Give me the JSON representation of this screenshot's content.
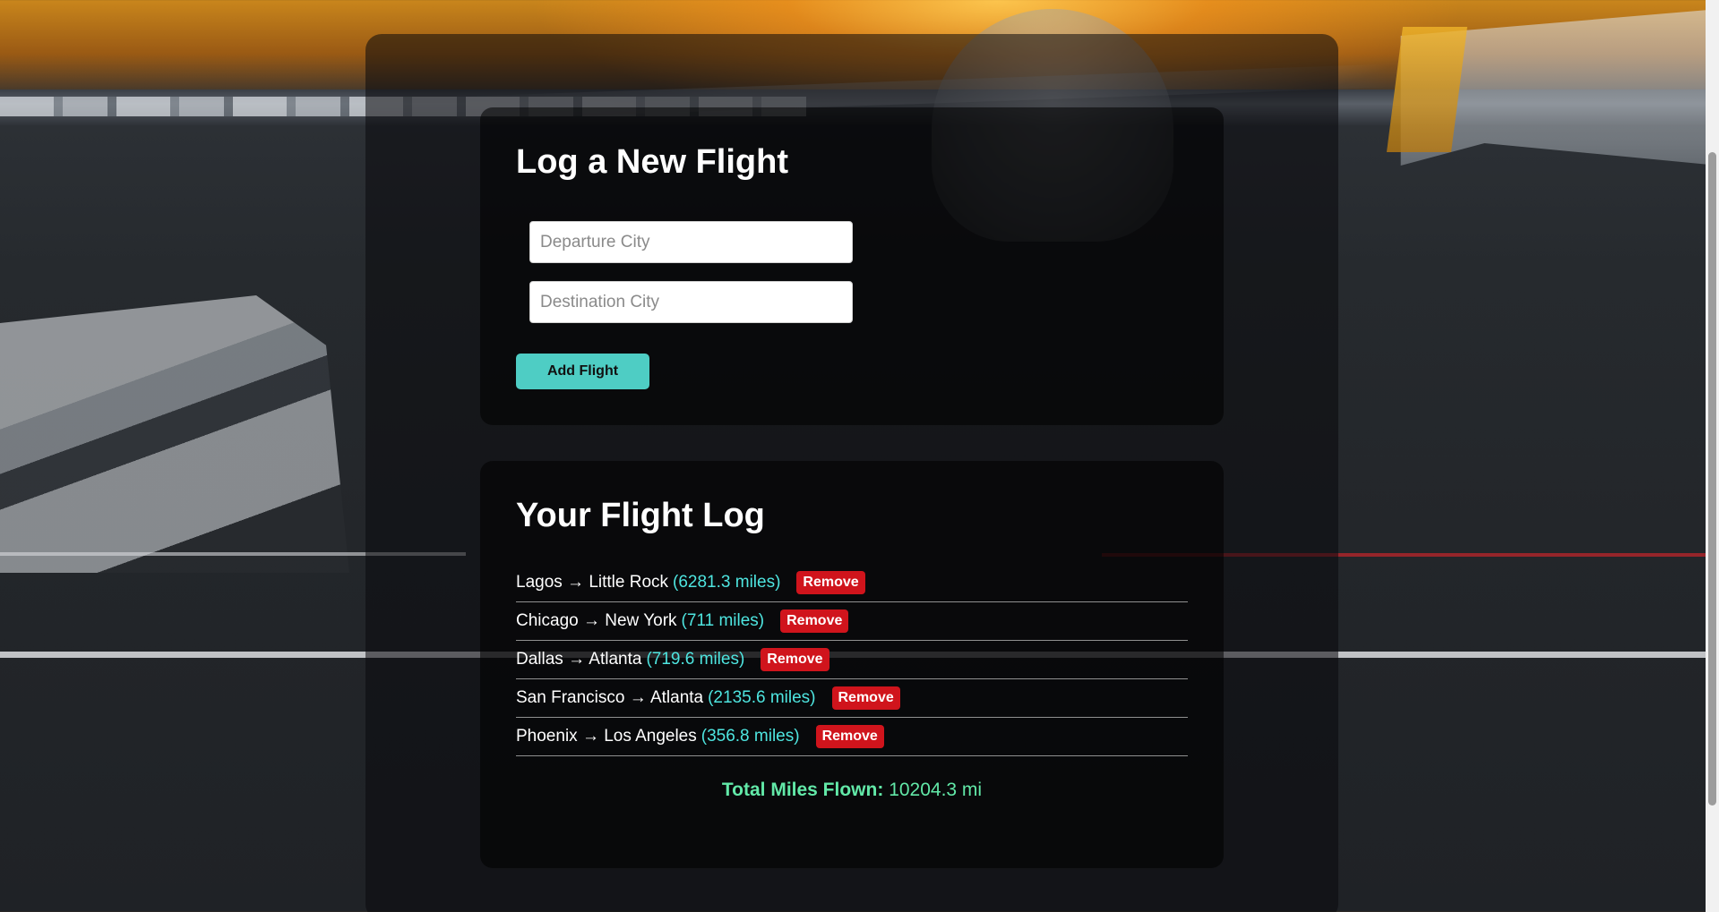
{
  "form": {
    "title": "Log a New Flight",
    "departure_placeholder": "Departure City",
    "departure_value": "",
    "destination_placeholder": "Destination City",
    "destination_value": "",
    "add_button_label": "Add Flight"
  },
  "log": {
    "title": "Your Flight Log",
    "remove_label": "Remove",
    "flights": [
      {
        "route": "Lagos → Little Rock",
        "miles": "(6281.3 miles)"
      },
      {
        "route": "Chicago → New York",
        "miles": "(711 miles)"
      },
      {
        "route": "Dallas → Atlanta",
        "miles": "(719.6 miles)"
      },
      {
        "route": "San Francisco → Atlanta",
        "miles": "(2135.6 miles)"
      },
      {
        "route": "Phoenix → Los Angeles",
        "miles": "(356.8 miles)"
      }
    ],
    "total_label": "Total Miles Flown:",
    "total_value": "10204.3 mi"
  },
  "colors": {
    "accent_button": "#4ecdc4",
    "remove_button": "#d0141c",
    "miles_text": "#4ee5e0",
    "total_text": "#62e9a8"
  }
}
